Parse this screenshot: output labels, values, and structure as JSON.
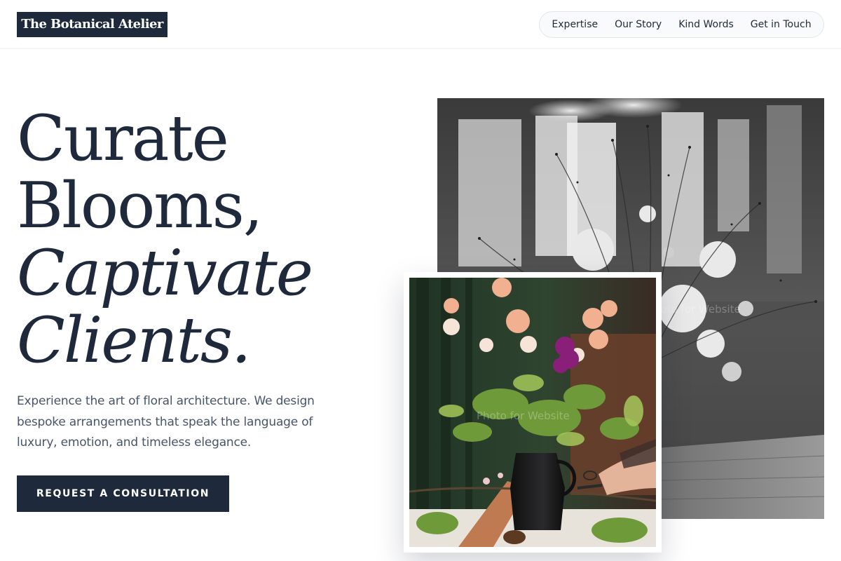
{
  "brand": {
    "name": "The Botanical Atelier",
    "colors": {
      "primary": "#1e293b",
      "text_muted": "#475569",
      "nav_bg": "#f8fafc",
      "nav_border": "#e2e6eb"
    }
  },
  "nav": {
    "items": [
      {
        "label": "Expertise"
      },
      {
        "label": "Our Story"
      },
      {
        "label": "Kind Words"
      },
      {
        "label": "Get in Touch"
      }
    ]
  },
  "hero": {
    "headline_line1": "Curate",
    "headline_line2": "Blooms,",
    "headline_line3": "Captivate",
    "headline_line4": "Clients.",
    "description": "Experience the art of floral architecture. We design bespoke arrangements that speak the language of luxury, emotion, and timeless elegance.",
    "cta_label": "REQUEST A CONSULTATION"
  },
  "images": {
    "back_photo": {
      "subject": "black and white photo of a wild floral arrangement on a wooden table",
      "icon": "photo-image"
    },
    "front_photo": {
      "subject": "color photo of hands trimming a bouquet of peach, pink and purple flowers in a black pitcher",
      "icon": "photo-image"
    },
    "watermark": "Photo for Website"
  }
}
